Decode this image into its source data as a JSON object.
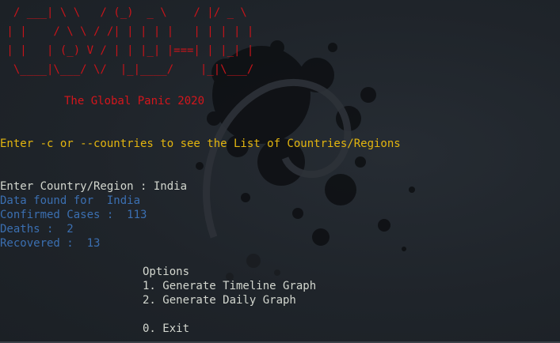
{
  "banner": {
    "ascii_lines": [
      "  / ___| \\ \\   / (_)  _ \\    / |/ _ \\",
      " | |    / \\ \\ / /| | | | |   | | | | |",
      " | |   | (_) V / | | |_| |===| | |_| |",
      "  \\____|\\___/ \\/  |_|____/    |_|\\___/",
      ""
    ],
    "tagline": "The Global Panic 2020"
  },
  "hint": "Enter -c or --countries to see the List of Countries/Regions",
  "query": {
    "prompt": "Enter Country/Region : ",
    "value": "India"
  },
  "results": {
    "found": "Data found for  India",
    "confirmed": "Confirmed Cases :  113",
    "deaths": "Deaths :  2",
    "recovered": "Recovered :  13"
  },
  "menu": {
    "title": "Options",
    "items": [
      "1. Generate Timeline Graph",
      "2. Generate Daily Graph",
      "",
      "0. Exit"
    ]
  },
  "colors": {
    "banner": "#c8141a",
    "hint": "#e3b50f",
    "result": "#3b6fb1",
    "text": "#d3d7cf",
    "background": "#1e2328"
  }
}
